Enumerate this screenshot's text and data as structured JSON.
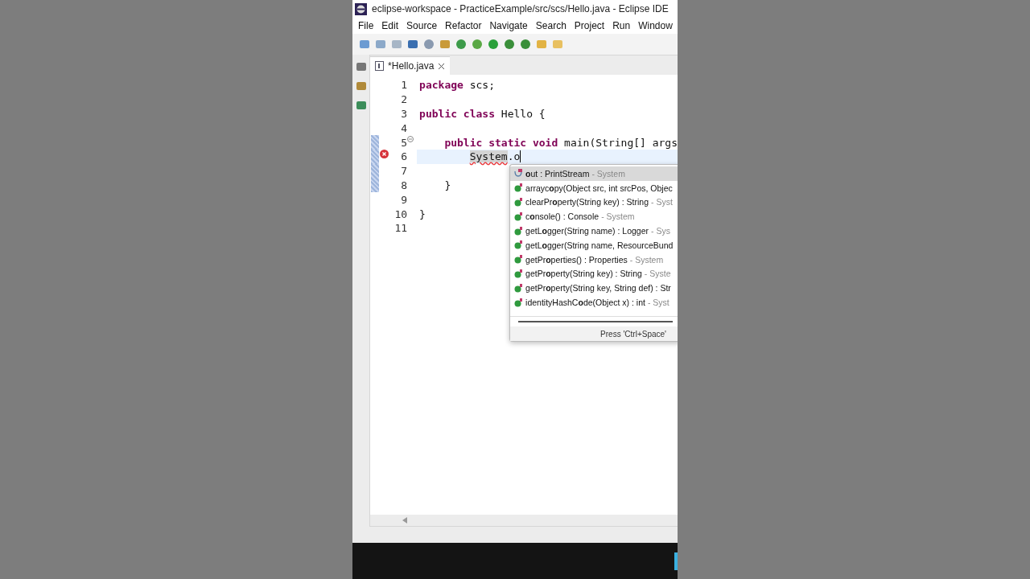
{
  "window": {
    "title": "eclipse-workspace - PracticeExample/src/scs/Hello.java - Eclipse IDE"
  },
  "menu": [
    "File",
    "Edit",
    "Source",
    "Refactor",
    "Navigate",
    "Search",
    "Project",
    "Run",
    "Window"
  ],
  "editor_tabs": [
    {
      "label": "*Hello.java",
      "selected": true
    }
  ],
  "code_lines": [
    {
      "number": "1",
      "tokens": [
        {
          "text": "package",
          "kind": "keyword"
        },
        {
          "text": " scs;",
          "kind": "plain"
        }
      ],
      "current": false,
      "error": false,
      "changed": false,
      "foldable": false
    },
    {
      "number": "2",
      "current": false,
      "error": false,
      "changed": false,
      "foldable": false
    },
    {
      "number": "3",
      "tokens": [
        {
          "text": "public class",
          "kind": "keyword"
        },
        {
          "text": " Hello {",
          "kind": "plain"
        }
      ],
      "current": false,
      "error": false,
      "changed": false,
      "foldable": false
    },
    {
      "number": "4",
      "current": false,
      "error": false,
      "changed": false,
      "foldable": false
    },
    {
      "number": "5",
      "tokens": [
        {
          "text": "    public static void",
          "kind": "keyword"
        },
        {
          "text": " main(String[] args",
          "kind": "plain"
        }
      ],
      "current": false,
      "error": false,
      "changed": true,
      "foldable": true
    },
    {
      "number": "6",
      "tokens": [
        {
          "text": "        System",
          "kind": "error"
        },
        {
          "text": ".o",
          "kind": "plain"
        }
      ],
      "current": true,
      "error": true,
      "changed": true,
      "foldable": false
    },
    {
      "number": "7",
      "current": false,
      "error": false,
      "changed": true,
      "foldable": false
    },
    {
      "number": "8",
      "tokens": [
        {
          "text": "    }",
          "kind": "plain"
        }
      ],
      "current": false,
      "error": false,
      "changed": true,
      "foldable": false
    },
    {
      "number": "9",
      "current": false,
      "error": false,
      "changed": false,
      "foldable": false
    },
    {
      "number": "10",
      "tokens": [
        {
          "text": "}",
          "kind": "plain"
        }
      ],
      "current": false,
      "error": false,
      "changed": false,
      "foldable": false
    },
    {
      "number": "11",
      "current": false,
      "error": false,
      "changed": false,
      "foldable": false
    }
  ],
  "completions": [
    {
      "kind": "field",
      "label": "**o**ut : PrintStream",
      "qualifier": " - System",
      "selected": true
    },
    {
      "kind": "method",
      "label": "arrayc**o**py(Object src, int srcPos, Objec",
      "selected": false
    },
    {
      "kind": "method",
      "label": "clearPr**o**perty(String key) : String",
      "qualifier": " - Syst",
      "selected": false
    },
    {
      "kind": "method",
      "label": "c**o**nsole() : Console",
      "qualifier": " - System",
      "selected": false
    },
    {
      "kind": "method",
      "label": "getL**o**gger(String name) : Logger",
      "qualifier": " - Sys",
      "selected": false
    },
    {
      "kind": "method",
      "label": "getL**o**gger(String name, ResourceBund",
      "selected": false
    },
    {
      "kind": "method",
      "label": "getPr**o**perties() : Properties",
      "qualifier": " - System",
      "selected": false
    },
    {
      "kind": "method",
      "label": "getPr**o**perty(String key) : String",
      "qualifier": " - Syste",
      "selected": false
    },
    {
      "kind": "method",
      "label": "getPr**o**perty(String key, String def) : Str",
      "selected": false
    },
    {
      "kind": "method",
      "label": "identityHashC**o**de(Object x) : int",
      "qualifier": " - Syst",
      "selected": false
    }
  ],
  "completion_hint": "Press 'Ctrl+Space'"
}
